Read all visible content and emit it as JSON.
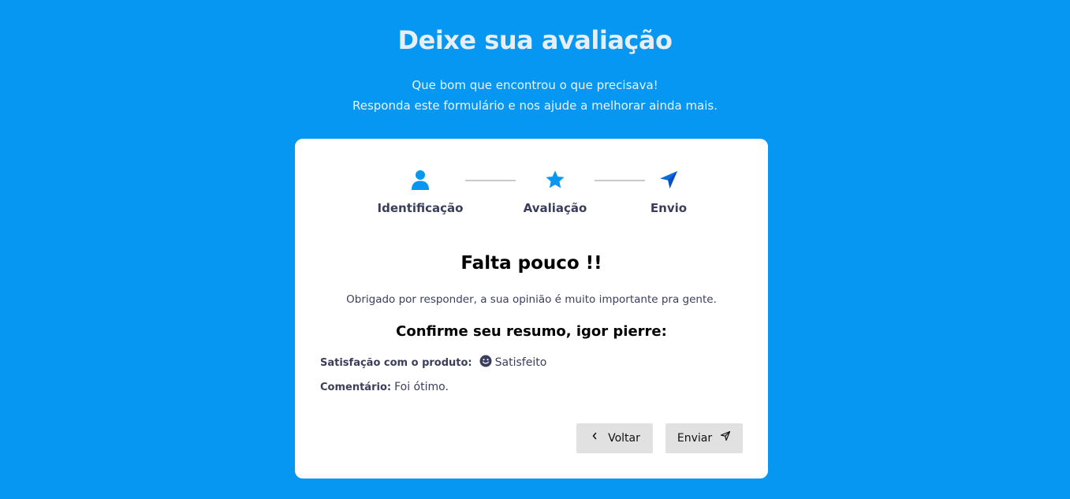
{
  "header": {
    "title": "Deixe sua avaliação",
    "subtitle_line1": "Que bom que encontrou o que precisava!",
    "subtitle_line2": "Responda este formulário e nos ajude a melhorar ainda mais."
  },
  "steps": [
    {
      "label": "Identificação",
      "icon": "user-icon"
    },
    {
      "label": "Avaliação",
      "icon": "star-icon"
    },
    {
      "label": "Envio",
      "icon": "send-icon"
    }
  ],
  "colors": {
    "background": "#0597f2",
    "accent": "#0597f2",
    "text": "#3a3e5c",
    "button_bg": "#e1e1e1",
    "card": "#ffffff"
  },
  "content": {
    "title": "Falta pouco !!",
    "message": "Obrigado por responder, a sua opinião é muito importante pra gente.",
    "confirm": "Confirme seu resumo, igor pierre:"
  },
  "summary": {
    "satisfaction_label": "Satisfação com o produto:",
    "satisfaction_value": "Satisfeito",
    "satisfaction_icon": "smile-icon",
    "comment_label": "Comentário:",
    "comment_value": "Foi ótimo."
  },
  "buttons": {
    "back_label": "Voltar",
    "send_label": "Enviar"
  }
}
